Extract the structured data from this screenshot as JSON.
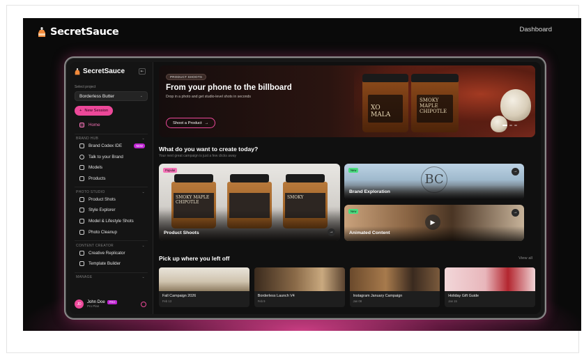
{
  "header": {
    "brand": "SecretSauce",
    "nav_link": "Dashboard"
  },
  "sidebar": {
    "brand": "SecretSauce",
    "project_label": "Select project",
    "project_value": "Borderless Butter",
    "new_session": "New Session",
    "home": "Home",
    "sections": [
      {
        "title": "BRAND HUB",
        "items": [
          {
            "label": "Brand Codex IDE",
            "badge": "NEW"
          },
          {
            "label": "Talk to your Brand"
          },
          {
            "label": "Models"
          },
          {
            "label": "Products"
          }
        ]
      },
      {
        "title": "PHOTO STUDIO",
        "items": [
          {
            "label": "Product Shots"
          },
          {
            "label": "Style Explorer"
          },
          {
            "label": "Model & Lifestyle Shots"
          },
          {
            "label": "Photo Cleanup"
          }
        ]
      },
      {
        "title": "CONTENT CREATOR",
        "items": [
          {
            "label": "Creative Replicator"
          },
          {
            "label": "Template Builder"
          }
        ]
      },
      {
        "title": "MANAGE",
        "items": []
      }
    ],
    "user": {
      "initials": "JD",
      "name": "John Doe",
      "badge": "PRO",
      "plan": "Pro Plan"
    }
  },
  "banner": {
    "pill": "PRODUCT SHOOTS",
    "title": "From your phone to the billboard",
    "subtitle": "Drop in a photo and get studio-level shots in seconds",
    "cta": "Shoot a Product",
    "jar_left_label": "XO MALA",
    "jar_right_label": "SMOKY MAPLE CHIPOTLE"
  },
  "create": {
    "title": "What do you want to create today?",
    "subtitle": "Your next great campaign is just a few clicks away",
    "cards": [
      {
        "tag": "Popular",
        "title": "Product Shoots"
      },
      {
        "tag": "",
        "title": "Brand Exploration"
      },
      {
        "tag": "New",
        "title": "Animated Content"
      }
    ],
    "jar_labels": [
      "SMOKY MAPLE CHIPOTLE",
      "",
      "SMOKY"
    ]
  },
  "recent": {
    "title": "Pick up where you left off",
    "view_all": "View all",
    "items": [
      {
        "name": "Fall Campaign 2026",
        "date": "Feb 13"
      },
      {
        "name": "Borderless Launch V4",
        "date": "Feb 9"
      },
      {
        "name": "Instagram January Campaign",
        "date": "Jan 08"
      },
      {
        "name": "Holiday Gift Guide",
        "date": "Jan 15"
      }
    ]
  },
  "colors": {
    "accent": "#ec4899",
    "background": "#0a0a0a",
    "badge": "#c026d3",
    "new_tag": "#4ade80"
  }
}
